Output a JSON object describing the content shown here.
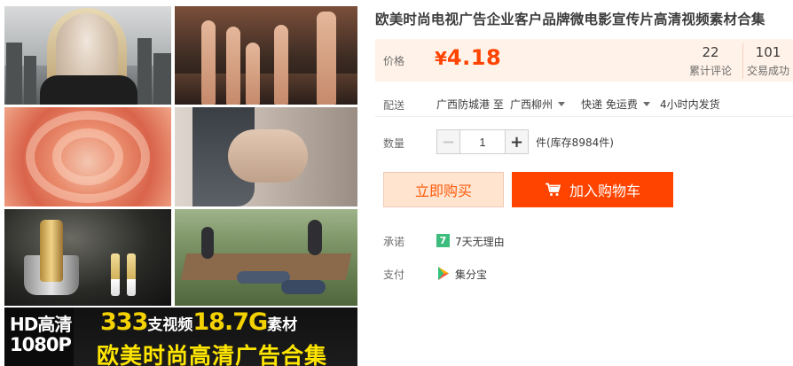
{
  "product": {
    "title": "欧美时尚电视广告企业客户品牌微电影宣传片高清视频素材合集"
  },
  "gallery": {
    "banner": {
      "hd_line1": "HD高清",
      "hd_line2": "1080P",
      "count_num": "333",
      "count_word": "支视频",
      "size_num": "18.7G",
      "size_word": "素材",
      "bottom_text": "欧美时尚高清广告合集"
    }
  },
  "price": {
    "label": "价格",
    "currency": "¥",
    "value": "4.18",
    "reviews_count": "22",
    "reviews_label": "累计评论",
    "sold_count": "101",
    "sold_label": "交易成功"
  },
  "shipping": {
    "label": "配送",
    "from": "广西防城港 至",
    "to": "广西柳州",
    "method": "快递 免运费",
    "dispatch": "4小时内发货"
  },
  "quantity": {
    "label": "数量",
    "value": "1",
    "stock": "件(库存8984件)"
  },
  "actions": {
    "buy_now": "立即购买",
    "add_to_cart": "加入购物车"
  },
  "promise": {
    "label": "承诺",
    "badge": "7",
    "text": "7天无理由"
  },
  "payment": {
    "label": "支付",
    "method": "集分宝"
  },
  "colors": {
    "accent": "#ff4400",
    "price_bg": "#fff2e8",
    "buy_now_bg": "#ffe4d0",
    "promise_badge": "#3dbd7d"
  }
}
